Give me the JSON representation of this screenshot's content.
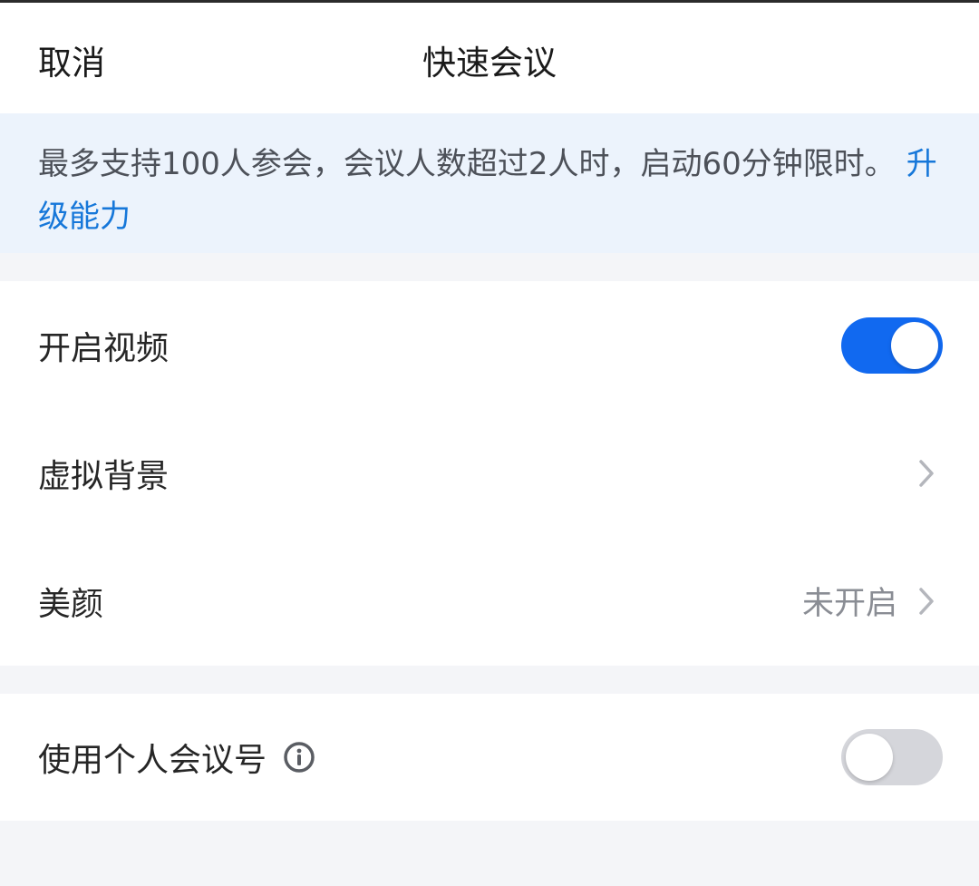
{
  "header": {
    "cancel_label": "取消",
    "title": "快速会议"
  },
  "notice": {
    "text": "最多支持100人参会，会议人数超过2人时，启动60分钟限时。",
    "link_label": "升级能力"
  },
  "settings": {
    "video": {
      "label": "开启视频",
      "enabled": true
    },
    "virtual_background": {
      "label": "虚拟背景"
    },
    "beauty": {
      "label": "美颜",
      "value": "未开启"
    },
    "personal_meeting_id": {
      "label": "使用个人会议号",
      "enabled": false
    }
  },
  "colors": {
    "accent": "#1169f0",
    "link": "#1677d9",
    "notice_bg": "#ecf3fc"
  },
  "icons": {
    "info": "info-circle-icon",
    "chevron": "chevron-right-icon"
  }
}
